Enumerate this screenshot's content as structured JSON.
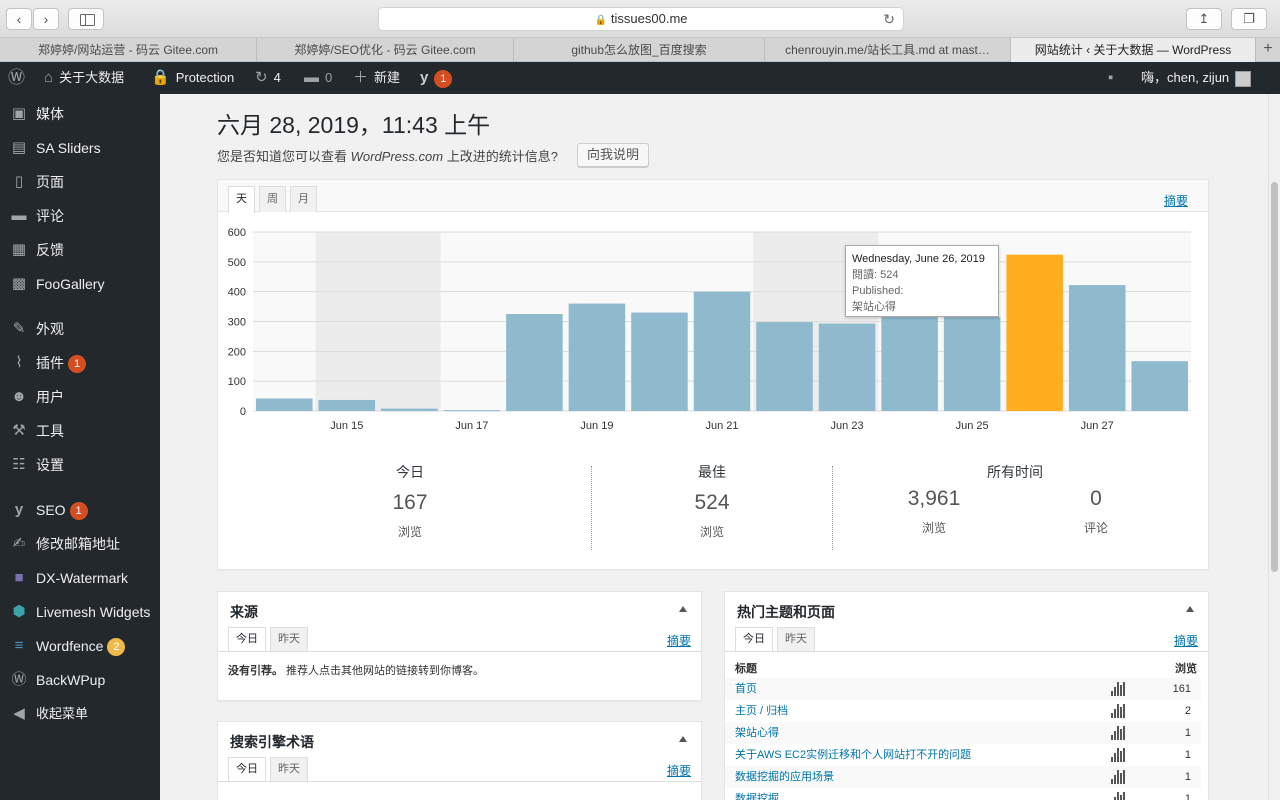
{
  "browser": {
    "url": "tissues00.me",
    "tabs": [
      {
        "label": "郑婷婷/网站运营 - 码云 Gitee.com",
        "active": false
      },
      {
        "label": "郑婷婷/SEO优化 - 码云 Gitee.com",
        "active": false
      },
      {
        "label": "github怎么放图_百度搜索",
        "active": false
      },
      {
        "label": "chenrouyin.me/站长工具.md at mast…",
        "active": false
      },
      {
        "label": "网站统计 ‹ 关于大数据 — WordPress",
        "active": true
      }
    ],
    "new_tab": "+"
  },
  "adminbar": {
    "site_name": "关于大数据",
    "protection": "Protection",
    "updates": "4",
    "comments": "0",
    "new": "新建",
    "seo_badge": "1",
    "greeting": "嗨，chen, zijun"
  },
  "menu": {
    "items": [
      {
        "label": "媒体",
        "icon": "media-icon"
      },
      {
        "label": "SA Sliders",
        "icon": "sliders-icon"
      },
      {
        "label": "页面",
        "icon": "page-icon"
      },
      {
        "label": "评论",
        "icon": "comment-icon"
      },
      {
        "label": "反馈",
        "icon": "feedback-icon"
      },
      {
        "label": "FooGallery",
        "icon": "gallery-icon"
      },
      {
        "label": "外观",
        "icon": "brush-icon"
      },
      {
        "label": "插件",
        "icon": "plugin-icon",
        "badge": "1"
      },
      {
        "label": "用户",
        "icon": "user-icon"
      },
      {
        "label": "工具",
        "icon": "wrench-icon"
      },
      {
        "label": "设置",
        "icon": "settings-icon"
      },
      {
        "label": "SEO",
        "icon": "yoast-icon",
        "badge": "1"
      },
      {
        "label": "修改邮箱地址",
        "icon": "edit-icon"
      },
      {
        "label": "DX-Watermark",
        "icon": "watermark-icon"
      },
      {
        "label": "Livemesh Widgets",
        "icon": "livemesh-icon"
      },
      {
        "label": "Wordfence",
        "icon": "wordfence-icon",
        "badge": "2",
        "badge_color": "#f0b849"
      },
      {
        "label": "BackWPup",
        "icon": "backwpup-icon"
      },
      {
        "label": "收起菜单",
        "icon": "collapse-icon"
      }
    ]
  },
  "page": {
    "date_title": "六月 28, 2019，11:43 上午",
    "notice_prefix": "您是否知道您可以查看 ",
    "notice_em": "WordPress.com",
    "notice_suffix": " 上改进的统计信息?",
    "notice_button": "向我说明"
  },
  "stats": {
    "tabs": [
      "天",
      "周",
      "月"
    ],
    "active_tab": "天",
    "summary_link": "摘要",
    "tooltip": {
      "title": "Wednesday, June 26, 2019",
      "views": "閱讀: 524",
      "published": "Published:",
      "post": "架站心得"
    },
    "summary": {
      "today_label": "今日",
      "today_value": "167",
      "today_sub": "浏览",
      "best_label": "最佳",
      "best_value": "524",
      "best_sub": "浏览",
      "all_label": "所有时间",
      "all_views": "3,961",
      "all_views_sub": "浏览",
      "all_comments": "0",
      "all_comments_sub": "评论"
    }
  },
  "chart_data": {
    "type": "bar",
    "categories": [
      "Jun 14",
      "Jun 15",
      "Jun 16",
      "Jun 17",
      "Jun 18",
      "Jun 19",
      "Jun 20",
      "Jun 21",
      "Jun 22",
      "Jun 23",
      "Jun 24",
      "Jun 25",
      "Jun 26",
      "Jun 27",
      "Jun 28"
    ],
    "values": [
      42,
      37,
      8,
      3,
      325,
      360,
      330,
      400,
      298,
      293,
      315,
      315,
      524,
      422,
      167
    ],
    "tick_labels": [
      "Jun 15",
      "Jun 17",
      "Jun 19",
      "Jun 21",
      "Jun 23",
      "Jun 25",
      "Jun 27"
    ],
    "ylim": [
      0,
      600
    ],
    "yticks": [
      0,
      100,
      200,
      300,
      400,
      500,
      600
    ],
    "highlight_index": 12,
    "weekend_bands": [
      [
        1,
        2
      ],
      [
        8,
        9
      ]
    ],
    "colors": {
      "bar": "#8fb9cc",
      "highlight": "#ffae1f",
      "weekend": "#ececec"
    },
    "grid": true
  },
  "referrers": {
    "title": "来源",
    "tabs": [
      "今日",
      "昨天"
    ],
    "summary_link": "摘要",
    "empty_bold": "没有引荐。",
    "empty_text": " 推荐人点击其他网站的链接转到你博客。"
  },
  "search_terms": {
    "title": "搜索引擎术语",
    "tabs": [
      "今日",
      "昨天"
    ],
    "summary_link": "摘要"
  },
  "top_posts": {
    "title": "热门主题和页面",
    "tabs": [
      "今日",
      "昨天"
    ],
    "summary_link": "摘要",
    "col_title": "标题",
    "col_views": "浏览",
    "rows": [
      {
        "title": "首页",
        "views": "161"
      },
      {
        "title": "主页 / 归档",
        "views": "2"
      },
      {
        "title": "架站心得",
        "views": "1"
      },
      {
        "title": "关于AWS EC2实例迁移和个人网站打不开的问题",
        "views": "1"
      },
      {
        "title": "数据挖掘的应用场景",
        "views": "1"
      },
      {
        "title": "数据挖掘",
        "views": "1"
      }
    ]
  }
}
